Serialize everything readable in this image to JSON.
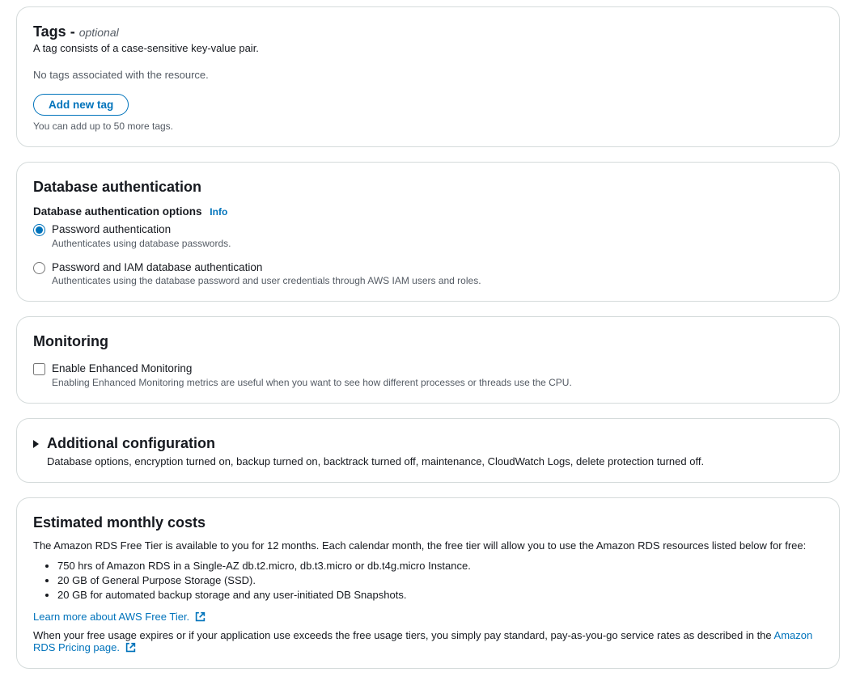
{
  "tags": {
    "title": "Tags",
    "dash": " - ",
    "optional": "optional",
    "desc": "A tag consists of a case-sensitive key-value pair.",
    "empty": "No tags associated with the resource.",
    "add_btn": "Add new tag",
    "hint": "You can add up to 50 more tags."
  },
  "auth": {
    "title": "Database authentication",
    "field_label": "Database authentication options",
    "info": "Info",
    "opt1_title": "Password authentication",
    "opt1_desc": "Authenticates using database passwords.",
    "opt2_title": "Password and IAM database authentication",
    "opt2_desc": "Authenticates using the database password and user credentials through AWS IAM users and roles."
  },
  "monitoring": {
    "title": "Monitoring",
    "opt_title": "Enable Enhanced Monitoring",
    "opt_desc": "Enabling Enhanced Monitoring metrics are useful when you want to see how different processes or threads use the CPU."
  },
  "additional": {
    "title": "Additional configuration",
    "desc": "Database options, encryption turned on, backup turned on, backtrack turned off, maintenance, CloudWatch Logs, delete protection turned off."
  },
  "costs": {
    "title": "Estimated monthly costs",
    "intro": "The Amazon RDS Free Tier is available to you for 12 months. Each calendar month, the free tier will allow you to use the Amazon RDS resources listed below for free:",
    "items": [
      "750 hrs of Amazon RDS in a Single-AZ db.t2.micro, db.t3.micro or db.t4g.micro Instance.",
      "20 GB of General Purpose Storage (SSD).",
      "20 GB for automated backup storage and any user-initiated DB Snapshots."
    ],
    "learn_link": "Learn more about AWS Free Tier.",
    "outro_pre": "When your free usage expires or if your application use exceeds the free usage tiers, you simply pay standard, pay-as-you-go service rates as described in the ",
    "outro_link": "Amazon RDS Pricing page."
  }
}
